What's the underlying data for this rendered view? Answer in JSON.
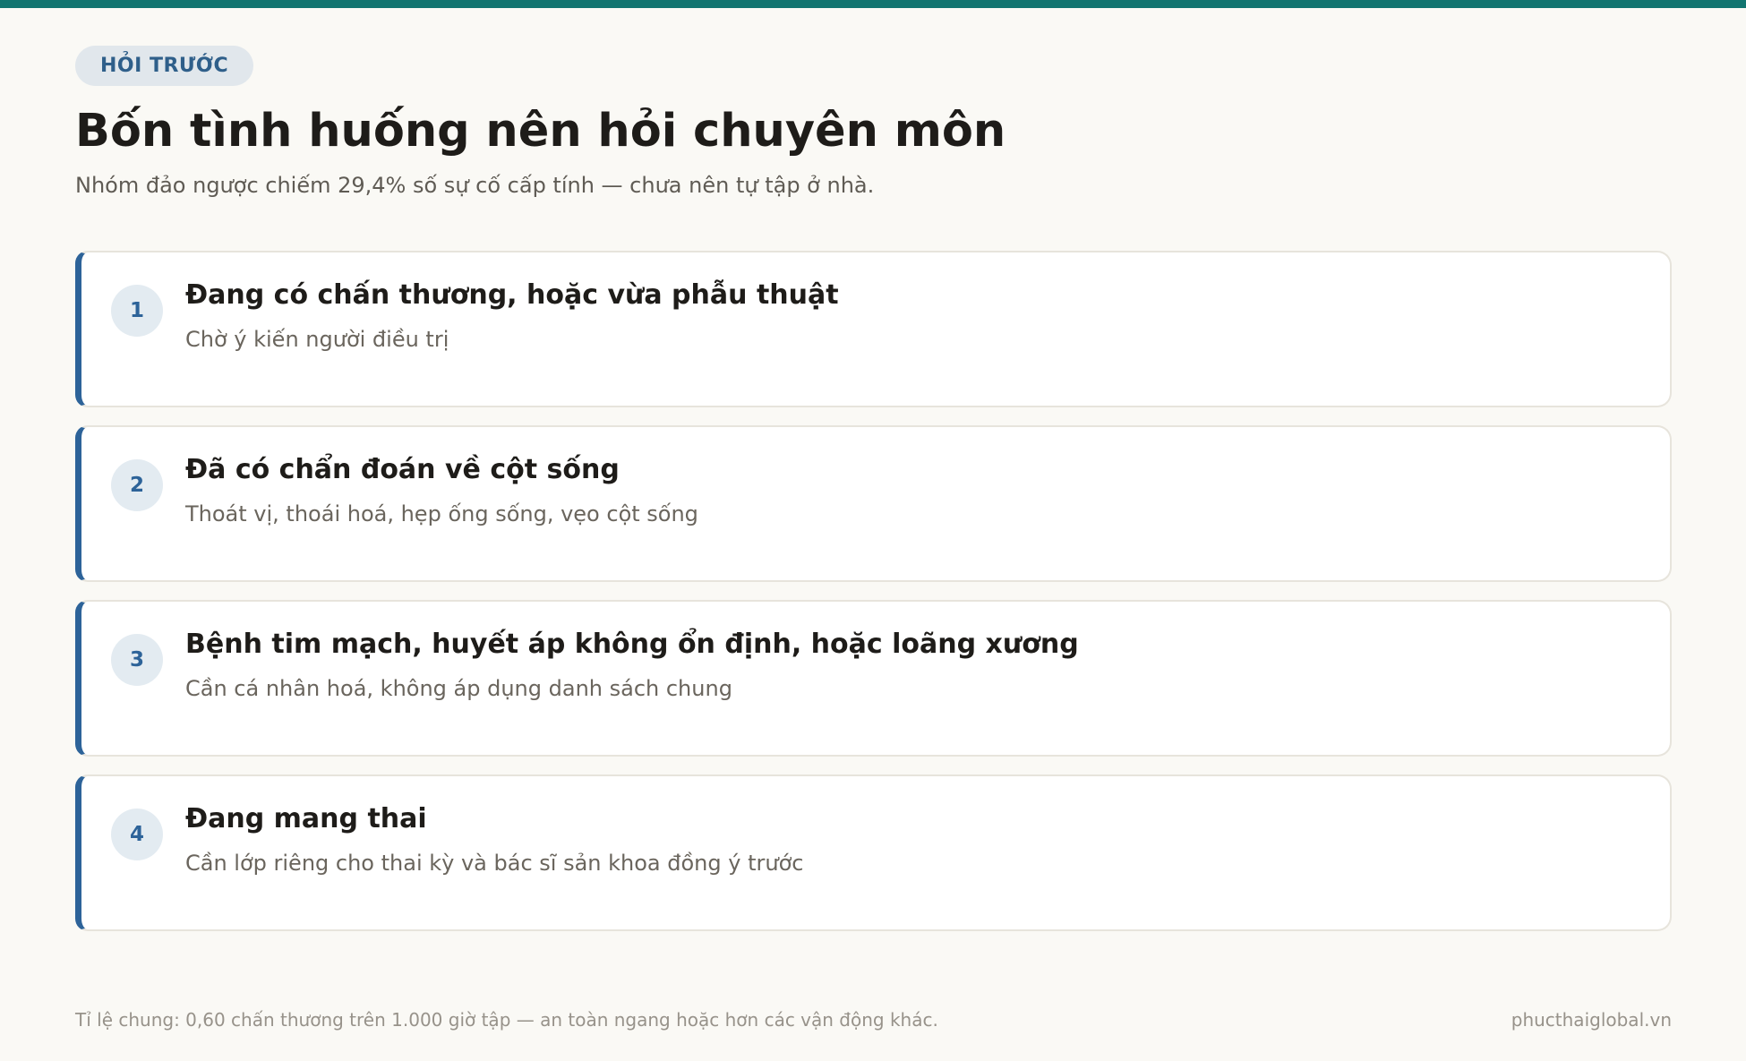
{
  "header": {
    "eyebrow": "HỎI TRƯỚC",
    "title": "Bốn tình huống nên hỏi chuyên môn",
    "subtitle": "Nhóm đảo ngược chiếm 29,4% số sự cố cấp tính — chưa nên tự tập ở nhà."
  },
  "cards": [
    {
      "number": "1",
      "title": "Đang có chấn thương, hoặc vừa phẫu thuật",
      "description": "Chờ ý kiến người điều trị"
    },
    {
      "number": "2",
      "title": "Đã có chẩn đoán về cột sống",
      "description": "Thoát vị, thoái hoá, hẹp ống sống, vẹo cột sống"
    },
    {
      "number": "3",
      "title": "Bệnh tim mạch, huyết áp không ổn định, hoặc loãng xương",
      "description": "Cần cá nhân hoá, không áp dụng danh sách chung"
    },
    {
      "number": "4",
      "title": "Đang mang thai",
      "description": "Cần lớp riêng cho thai kỳ và bác sĩ sản khoa đồng ý trước"
    }
  ],
  "footer": {
    "note": "Tỉ lệ chung: 0,60 chấn thương trên 1.000 giờ tập — an toàn ngang hoặc hơn các vận động khác.",
    "site": "phucthaiglobal.vn"
  },
  "colors": {
    "top_bar": "#127570",
    "accent": "#2d6399",
    "background": "#faf9f5"
  }
}
